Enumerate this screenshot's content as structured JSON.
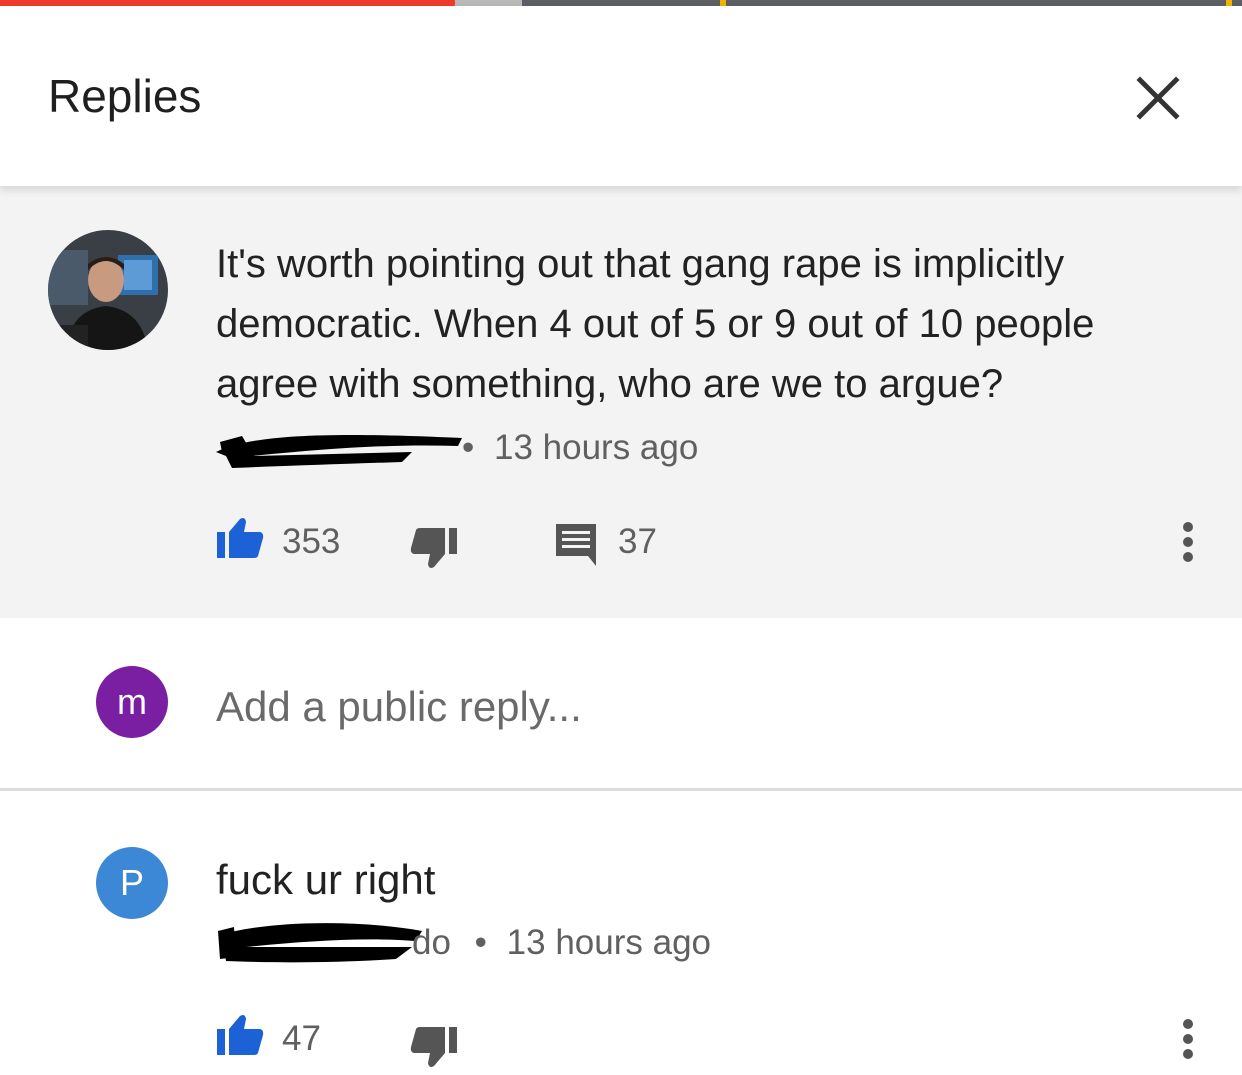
{
  "header": {
    "title": "Replies",
    "close_icon": "close-icon"
  },
  "video_progress": {
    "played_fraction": 0.35,
    "buffered_fraction": 0.42
  },
  "parent_comment": {
    "avatar": "user-photo",
    "text": "It's worth pointing out that gang rape is implicitly democratic.  When 4 out of 5 or 9 out of 10 people agree with something, who are we to argue?",
    "author": "[redacted]",
    "separator": "•",
    "time": "13 hours ago",
    "likes": "353",
    "replies": "37"
  },
  "reply_input": {
    "avatar_letter": "m",
    "avatar_color": "#7b1fa2",
    "placeholder": "Add a public reply..."
  },
  "replies": [
    {
      "avatar_letter": "P",
      "avatar_color": "#3c88d6",
      "text": "fuck ur right",
      "author": "[redacted]",
      "author_suffix": "do",
      "separator": "•",
      "time": "13 hours ago",
      "likes": "47"
    }
  ],
  "colors": {
    "like_blue": "#1c62d6",
    "progress_red": "#ee3a2a",
    "panel_gray": "#f3f3f3"
  }
}
